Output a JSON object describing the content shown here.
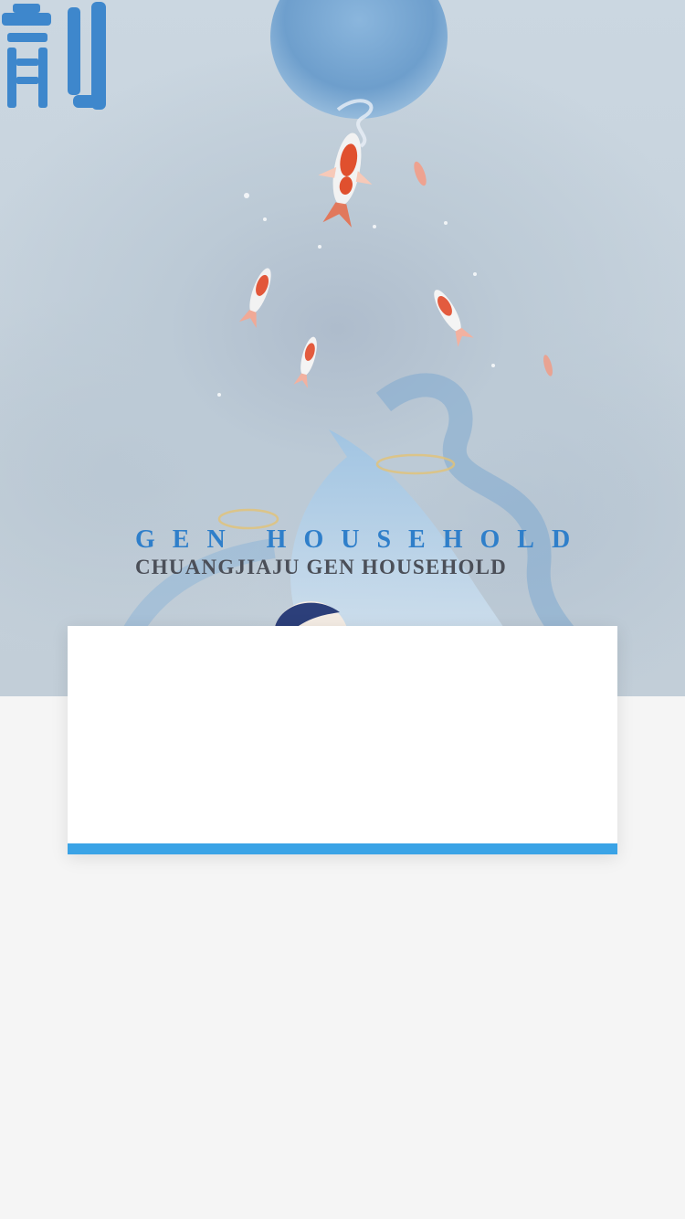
{
  "brand": {
    "title": "GEN HOUSEHOLD",
    "subtitle": "CHUANGJIAJU GEN HOUSEHOLD",
    "logo_icon": "brand-seal-icon"
  },
  "hero": {
    "illustration": "koi-fish-moon-watercolor-illustration"
  },
  "colors": {
    "brand_blue": "#2f7fca",
    "accent_bar": "#3aa3e6",
    "subtitle_gray": "#4b4f58",
    "page_bg": "#f5f5f5"
  }
}
